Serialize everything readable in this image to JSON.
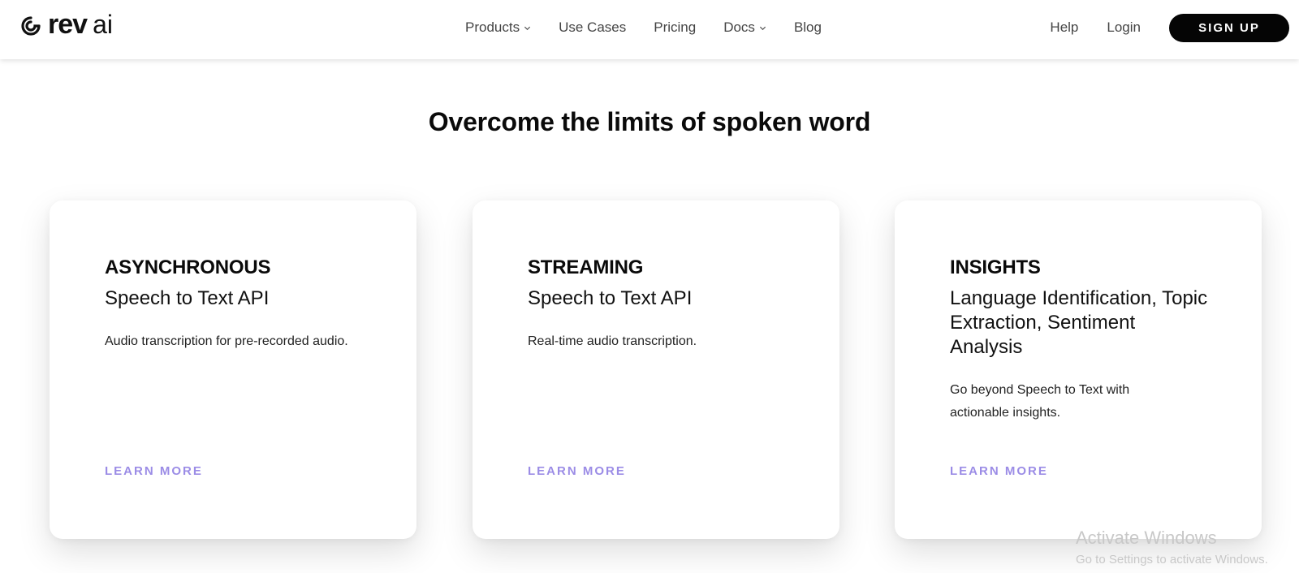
{
  "brand": {
    "logo_primary": "rev",
    "logo_secondary": "ai",
    "logo_icon": "rev-swirl-icon"
  },
  "nav": {
    "items": [
      {
        "label": "Products",
        "has_dropdown": true
      },
      {
        "label": "Use Cases",
        "has_dropdown": false
      },
      {
        "label": "Pricing",
        "has_dropdown": false
      },
      {
        "label": "Docs",
        "has_dropdown": true
      },
      {
        "label": "Blog",
        "has_dropdown": false
      }
    ],
    "help_label": "Help",
    "login_label": "Login",
    "signup_label": "SIGN UP"
  },
  "main": {
    "headline": "Overcome the limits of spoken word",
    "cards": [
      {
        "title": "ASYNCHRONOUS",
        "subtitle": "Speech to Text API",
        "description": "Audio transcription for pre-recorded audio.",
        "link_label": "LEARN MORE"
      },
      {
        "title": "STREAMING",
        "subtitle": "Speech to Text API",
        "description": "Real-time audio transcription.",
        "link_label": "LEARN MORE"
      },
      {
        "title": "INSIGHTS",
        "subtitle": "Language Identification, Topic Extraction, Sentiment Analysis",
        "description": "Go beyond Speech to Text with actionable insights.",
        "link_label": "LEARN MORE"
      }
    ]
  },
  "watermark": {
    "title": "Activate Windows",
    "subtitle": "Go to Settings to activate Windows."
  },
  "colors": {
    "accent_link": "#9b8ce6",
    "signup_bg": "#050505",
    "text_dark": "#0a0a0a"
  }
}
